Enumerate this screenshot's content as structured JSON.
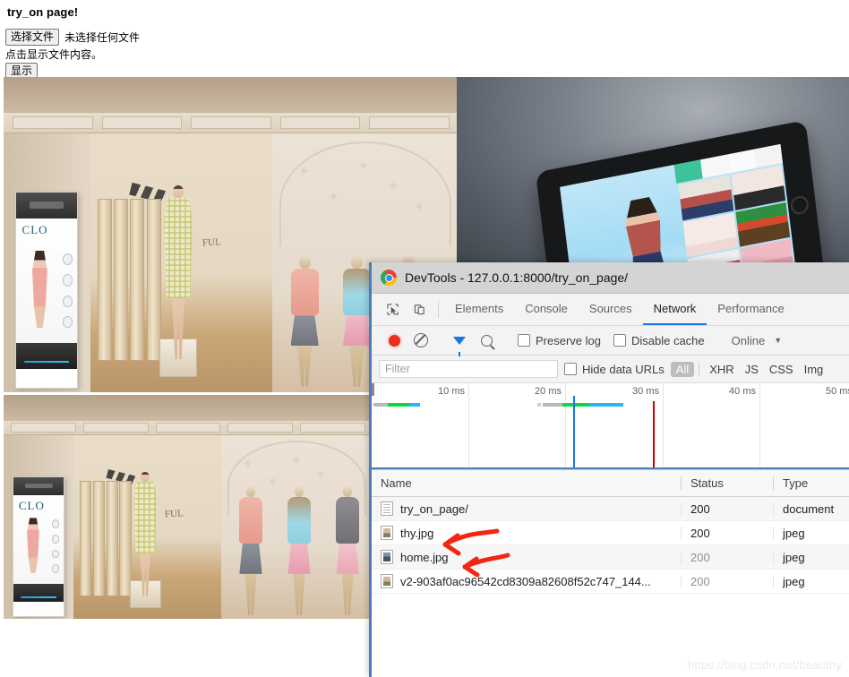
{
  "page": {
    "title": "try_on page!",
    "file_button_label": "选择文件",
    "file_status": "未选择任何文件",
    "hint": "点击显示文件内容。",
    "show_button_label": "显示"
  },
  "images": {
    "shop_kiosk_brand": "CLO",
    "shop_wall_sign": "FUL",
    "top_left_alt": "clothing-store-virtual-fitting-room",
    "bottom_left_alt": "clothing-store-virtual-fitting-room",
    "right_alt": "tablet-showing-virtual-try-on-app"
  },
  "devtools": {
    "window_title": "DevTools - 127.0.0.1:8000/try_on_page/",
    "tabs": [
      {
        "label": "Elements",
        "active": false
      },
      {
        "label": "Console",
        "active": false
      },
      {
        "label": "Sources",
        "active": false
      },
      {
        "label": "Network",
        "active": true
      },
      {
        "label": "Performance",
        "active": false
      }
    ],
    "toolbar": {
      "record_title": "record",
      "clear_title": "clear",
      "filter_title": "filter",
      "search_title": "search",
      "preserve_log": "Preserve log",
      "disable_cache": "Disable cache",
      "throttling": "Online"
    },
    "filterbar": {
      "filter_placeholder": "Filter",
      "hide_data_urls": "Hide data URLs",
      "types": [
        "All",
        "XHR",
        "JS",
        "CSS",
        "Img"
      ],
      "selected_type": "All"
    },
    "overview": {
      "ticks": [
        "10 ms",
        "20 ms",
        "30 ms",
        "40 ms",
        "50 ms"
      ],
      "dom_content_loaded_color": "#1a73e8",
      "load_event_color": "#cc0000",
      "bars": [
        {
          "label": "try_on_page/",
          "start_ms": 1.5,
          "stall_ms": 2.5,
          "green_ms": 4.0,
          "blue_ms": 1.6
        },
        {
          "label": "thy.jpg",
          "start_ms": 17.2,
          "stall_ms": 2.6,
          "green_ms": 3.5,
          "blue_ms": 4.6
        }
      ],
      "dom_content_loaded_ms": 20.6,
      "load_event_ms": 29.1
    },
    "table": {
      "columns": [
        "Name",
        "Status",
        "Type"
      ],
      "rows": [
        {
          "name": "try_on_page/",
          "status": "200",
          "type": "document",
          "icon": "document-icon",
          "dim": false
        },
        {
          "name": "thy.jpg",
          "status": "200",
          "type": "jpeg",
          "icon": "image-icon",
          "dim": false
        },
        {
          "name": "home.jpg",
          "status": "200",
          "type": "jpeg",
          "icon": "image-icon",
          "dim": true
        },
        {
          "name": "v2-903af0ac96542cd8309a82608f52c747_144...",
          "status": "200",
          "type": "jpeg",
          "icon": "image-icon",
          "dim": true
        }
      ]
    },
    "annotations": {
      "arrow_color": "#f22613",
      "arrow_targets": [
        "thy.jpg",
        "home.jpg"
      ]
    }
  },
  "watermark": "https://blog.csdn.net/beauthy"
}
